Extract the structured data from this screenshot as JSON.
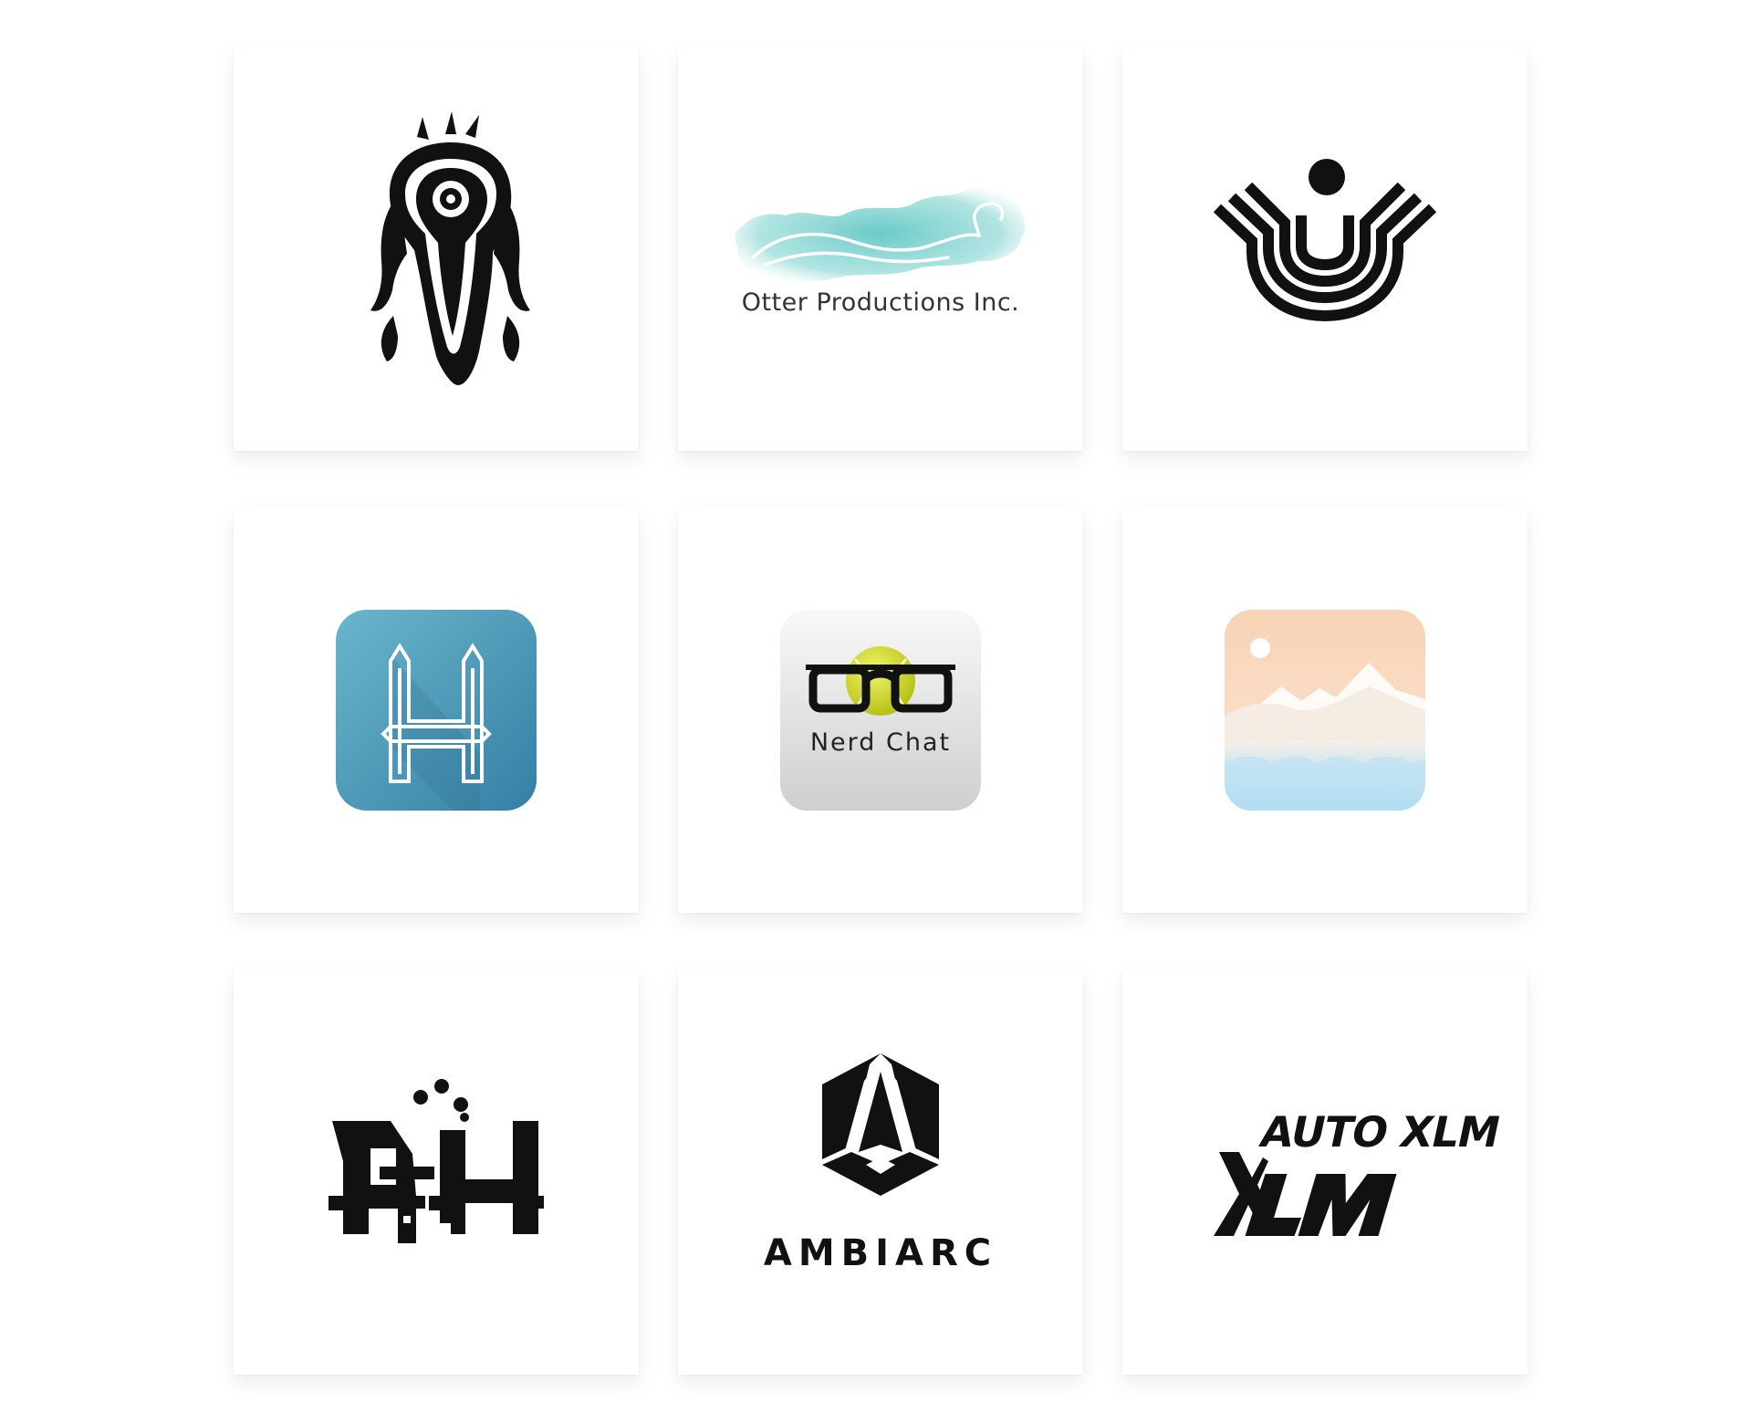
{
  "gallery": {
    "logos": [
      {
        "name": "Tribal Beetle",
        "icon": "tribal-beetle-icon",
        "wordmark": ""
      },
      {
        "name": "Otter Productions",
        "icon": "watercolor-otter-icon",
        "wordmark": "Otter Productions Inc."
      },
      {
        "name": "U Monogram",
        "icon": "u-monogram-icon",
        "wordmark": ""
      },
      {
        "name": "H App",
        "icon": "h-app-icon",
        "wordmark": ""
      },
      {
        "name": "Nerd Chat",
        "icon": "glasses-ball-icon",
        "wordmark": "Nerd Chat"
      },
      {
        "name": "Landscape App",
        "icon": "mountain-landscape-icon",
        "wordmark": ""
      },
      {
        "name": "AH",
        "icon": "ah-monogram-icon",
        "wordmark": ""
      },
      {
        "name": "Ambiarc",
        "icon": "hexagon-a-icon",
        "wordmark": "AMBIARC"
      },
      {
        "name": "AutoXLM",
        "icon": "auto-xlm-icon",
        "wordmark": "AUTO XLM"
      }
    ]
  },
  "colors": {
    "background": "#ffffff",
    "card": "#ffffff",
    "ink": "#111111",
    "otter_teal": "#7dd3cf",
    "h_app_blue": "#4a95b5",
    "nerd_yellow": "#d6e02a",
    "peach": "#f8d3b6",
    "sky_blue": "#8fd0f0"
  }
}
